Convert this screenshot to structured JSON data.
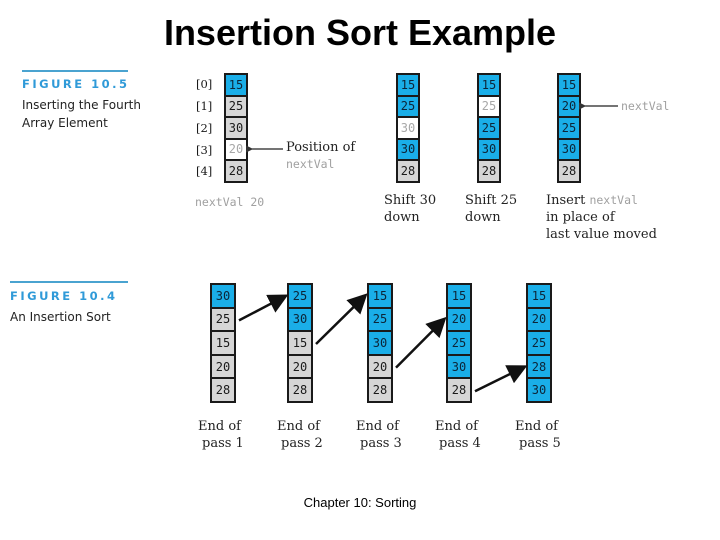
{
  "title": "Insertion Sort Example",
  "footer": "Chapter 10: Sorting",
  "colors": {
    "blue": "#1aaee8",
    "gray": "#d6d6d6",
    "white": "#ffffff",
    "figure_label": "#2f9ad8"
  },
  "figure_top": {
    "label": "FIGURE 10.5",
    "caption_line1": "Inserting the Fourth",
    "caption_line2": "Array Element",
    "indices": [
      "[0]",
      "[1]",
      "[2]",
      "[3]",
      "[4]"
    ],
    "position_label_line1": "Position of",
    "position_label_line2": "nextVal",
    "nextval_readout": "nextVal 20",
    "arrow_label": "nextVal",
    "columns": [
      {
        "cells": [
          {
            "v": "15",
            "s": "blue"
          },
          {
            "v": "25",
            "s": "gray"
          },
          {
            "v": "30",
            "s": "gray"
          },
          {
            "v": "20",
            "s": "white"
          },
          {
            "v": "28",
            "s": "gray"
          }
        ],
        "caption": []
      },
      {
        "cells": [
          {
            "v": "15",
            "s": "blue"
          },
          {
            "v": "25",
            "s": "blue"
          },
          {
            "v": "30",
            "s": "white"
          },
          {
            "v": "30",
            "s": "blue"
          },
          {
            "v": "28",
            "s": "gray"
          }
        ],
        "caption": [
          "Shift 30",
          "down"
        ]
      },
      {
        "cells": [
          {
            "v": "15",
            "s": "blue"
          },
          {
            "v": "25",
            "s": "white"
          },
          {
            "v": "25",
            "s": "blue"
          },
          {
            "v": "30",
            "s": "blue"
          },
          {
            "v": "28",
            "s": "gray"
          }
        ],
        "caption": [
          "Shift 25",
          "down"
        ]
      },
      {
        "cells": [
          {
            "v": "15",
            "s": "blue"
          },
          {
            "v": "20",
            "s": "blue"
          },
          {
            "v": "25",
            "s": "blue"
          },
          {
            "v": "30",
            "s": "blue"
          },
          {
            "v": "28",
            "s": "gray"
          }
        ],
        "caption": [
          "Insert",
          "in place of",
          "last value moved"
        ]
      }
    ],
    "insert_mono": "nextVal"
  },
  "figure_bottom": {
    "label": "FIGURE 10.4",
    "caption": "An Insertion Sort",
    "columns": [
      {
        "cells": [
          {
            "v": "30",
            "s": "blue"
          },
          {
            "v": "25",
            "s": "gray"
          },
          {
            "v": "15",
            "s": "gray"
          },
          {
            "v": "20",
            "s": "gray"
          },
          {
            "v": "28",
            "s": "gray"
          }
        ],
        "caption": [
          "End of",
          "pass 1"
        ]
      },
      {
        "cells": [
          {
            "v": "25",
            "s": "blue"
          },
          {
            "v": "30",
            "s": "blue"
          },
          {
            "v": "15",
            "s": "gray"
          },
          {
            "v": "20",
            "s": "gray"
          },
          {
            "v": "28",
            "s": "gray"
          }
        ],
        "caption": [
          "End of",
          "pass 2"
        ]
      },
      {
        "cells": [
          {
            "v": "15",
            "s": "blue"
          },
          {
            "v": "25",
            "s": "blue"
          },
          {
            "v": "30",
            "s": "blue"
          },
          {
            "v": "20",
            "s": "gray"
          },
          {
            "v": "28",
            "s": "gray"
          }
        ],
        "caption": [
          "End of",
          "pass 3"
        ]
      },
      {
        "cells": [
          {
            "v": "15",
            "s": "blue"
          },
          {
            "v": "20",
            "s": "blue"
          },
          {
            "v": "25",
            "s": "blue"
          },
          {
            "v": "30",
            "s": "blue"
          },
          {
            "v": "28",
            "s": "gray"
          }
        ],
        "caption": [
          "End of",
          "pass 4"
        ]
      },
      {
        "cells": [
          {
            "v": "15",
            "s": "blue"
          },
          {
            "v": "20",
            "s": "blue"
          },
          {
            "v": "25",
            "s": "blue"
          },
          {
            "v": "28",
            "s": "blue"
          },
          {
            "v": "30",
            "s": "blue"
          }
        ],
        "caption": [
          "End of",
          "pass 5"
        ]
      }
    ],
    "arrows": [
      {
        "from_col": 0,
        "from_row": 1,
        "to_col": 1,
        "to_row": 0
      },
      {
        "from_col": 1,
        "from_row": 2,
        "to_col": 2,
        "to_row": 0
      },
      {
        "from_col": 2,
        "from_row": 3,
        "to_col": 3,
        "to_row": 1
      },
      {
        "from_col": 3,
        "from_row": 4,
        "to_col": 4,
        "to_row": 3
      }
    ]
  }
}
